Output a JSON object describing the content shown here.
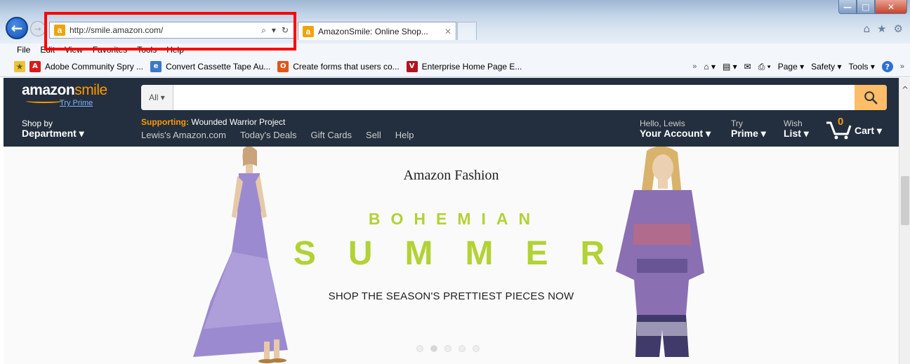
{
  "window": {
    "controls": [
      "—",
      "□",
      "✕"
    ]
  },
  "browser": {
    "back_icon": "back-arrow-icon",
    "forward_icon": "forward-arrow-icon",
    "address": "http://smile.amazon.com/",
    "address_icons": [
      "⌕",
      "▾",
      "↻"
    ],
    "tab_title": "AmazonSmile: Online Shop...",
    "tab_close": "✕",
    "right_tools": [
      "⌂",
      "★",
      "⚙"
    ]
  },
  "menubar": {
    "items": [
      "File",
      "Edit",
      "View",
      "Favorites",
      "Tools",
      "Help"
    ]
  },
  "favorites": {
    "items": [
      {
        "label": "Adobe Community Spry ...",
        "icon": "adobe-icon"
      },
      {
        "label": "Convert Cassette Tape Au...",
        "icon": "ie-page-icon"
      },
      {
        "label": "Create forms that users co...",
        "icon": "office-icon"
      },
      {
        "label": "Enterprise Home Page  E...",
        "icon": "enterprise-icon"
      }
    ],
    "overflow": "»",
    "command_bar": [
      "Page ▾",
      "Safety ▾",
      "Tools ▾"
    ],
    "overflow_right": "»"
  },
  "amazon": {
    "logo_main": "amazon",
    "logo_smile": "smile",
    "try_prime": "Try Prime",
    "search_dept": "All ▾",
    "search_placeholder": "",
    "shop_by_line1": "Shop by",
    "shop_by_line2": "Department ▾",
    "supporting_label": "Supporting:",
    "supporting_org": "Wounded Warrior Project",
    "nav_links": [
      "Lewis's Amazon.com",
      "Today's Deals",
      "Gift Cards",
      "Sell",
      "Help"
    ],
    "account_line1": "Hello, Lewis",
    "account_line2": "Your Account ▾",
    "prime_line1": "Try",
    "prime_line2": "Prime ▾",
    "wish_line1": "Wish",
    "wish_line2": "List ▾",
    "cart_count": "0",
    "cart_label": "Cart ▾"
  },
  "hero": {
    "title": "Amazon Fashion",
    "line1": "BOHEMIAN",
    "line2": "SUMMER",
    "cta": "SHOP THE SEASON'S PRETTIEST PIECES NOW",
    "slides": 5,
    "active_slide": 2
  },
  "colors": {
    "header_bg": "#232f3e",
    "accent_orange": "#ff9900",
    "search_btn": "#febd69",
    "hero_green": "#b2d235",
    "highlight_red": "#ff0000"
  }
}
